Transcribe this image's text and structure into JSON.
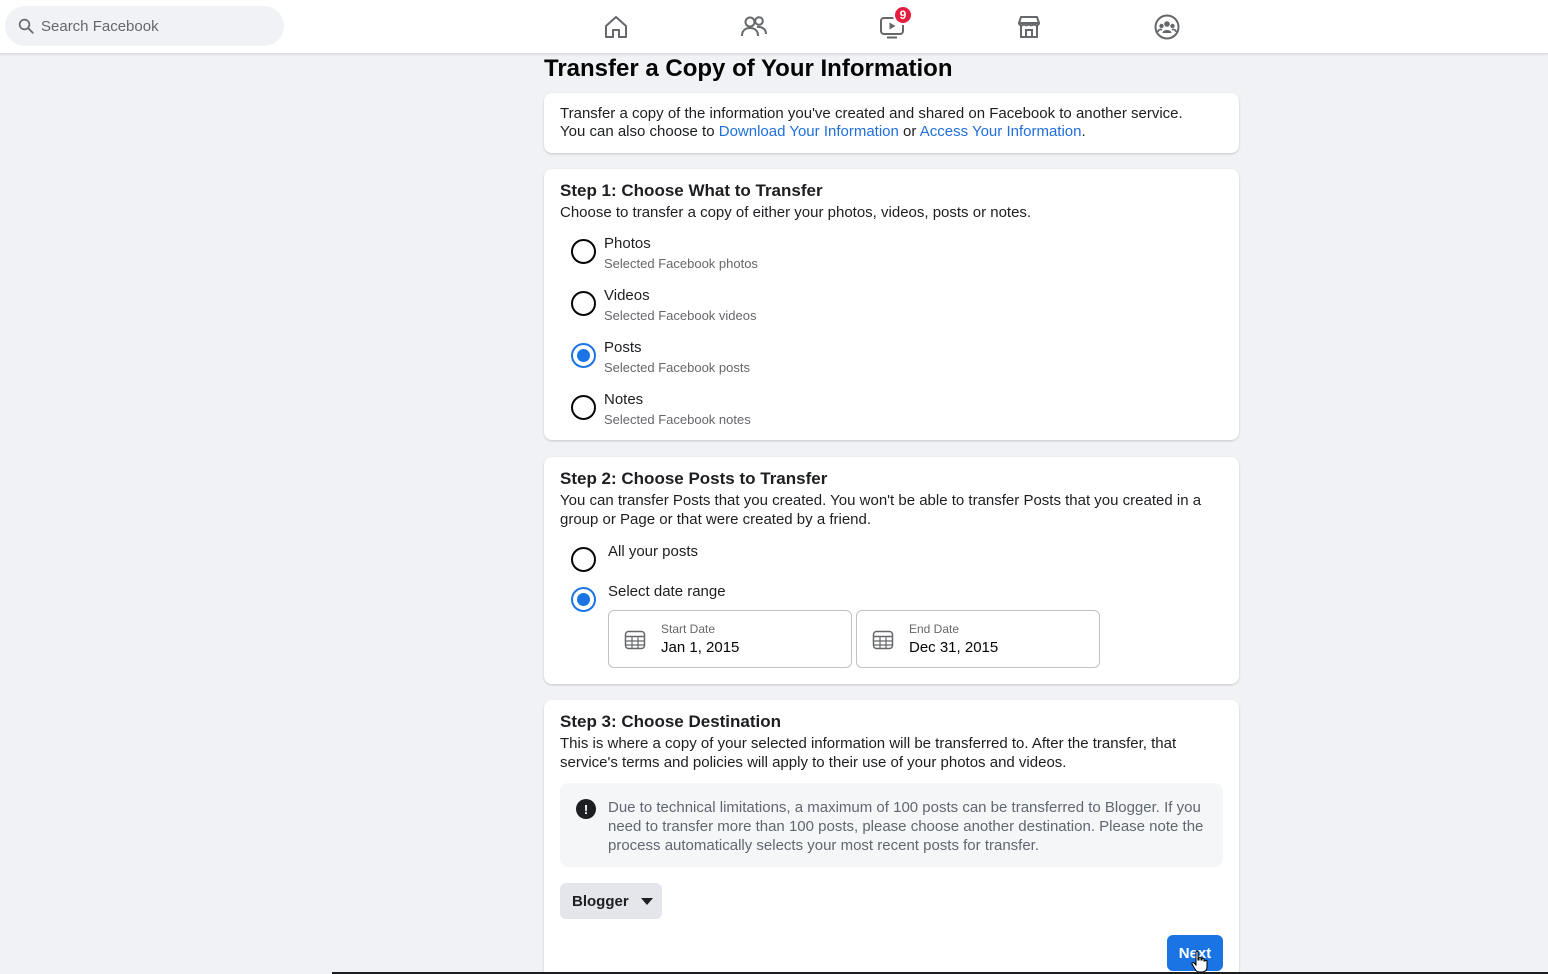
{
  "search": {
    "placeholder": "Search Facebook"
  },
  "nav": {
    "items": [
      {
        "icon": "home-icon"
      },
      {
        "icon": "friends-icon"
      },
      {
        "icon": "watch-icon",
        "badge": "9"
      },
      {
        "icon": "marketplace-icon"
      },
      {
        "icon": "groups-icon"
      }
    ]
  },
  "page": {
    "title": "Transfer a Copy of Your Information"
  },
  "intro": {
    "line1": "Transfer a copy of the information you've created and shared on Facebook to another service.",
    "line2_prefix": "You can also choose to ",
    "link1": "Download Your Information",
    "middle": " or ",
    "link2": "Access Your Information",
    "suffix": "."
  },
  "step1": {
    "title": "Step 1: Choose What to Transfer",
    "description": "Choose to transfer a copy of either your photos, videos, posts or notes.",
    "options": [
      {
        "label": "Photos",
        "sub": "Selected Facebook photos",
        "checked": false
      },
      {
        "label": "Videos",
        "sub": "Selected Facebook videos",
        "checked": false
      },
      {
        "label": "Posts",
        "sub": "Selected Facebook posts",
        "checked": true
      },
      {
        "label": "Notes",
        "sub": "Selected Facebook notes",
        "checked": false
      }
    ]
  },
  "step2": {
    "title": "Step 2: Choose Posts to Transfer",
    "description": "You can transfer Posts that you created. You won't be able to transfer Posts that you created in a group or Page or that were created by a friend.",
    "options": [
      {
        "label": "All your posts",
        "checked": false
      },
      {
        "label": "Select date range",
        "checked": true
      }
    ],
    "start_date": {
      "label": "Start Date",
      "value": "Jan 1, 2015"
    },
    "end_date": {
      "label": "End Date",
      "value": "Dec 31, 2015"
    }
  },
  "step3": {
    "title": "Step 3: Choose Destination",
    "description": "This is where a copy of your selected information will be transferred to. After the transfer, that service's terms and policies will apply to their use of your photos and videos.",
    "notice": "Due to technical limitations, a maximum of 100 posts can be transferred to Blogger. If you need to transfer more than 100 posts, please choose another destination. Please note the process automatically selects your most recent posts for transfer.",
    "destination": "Blogger",
    "next_label": "Next"
  },
  "colors": {
    "accent": "#1b74e4",
    "link": "#216fdb",
    "badge": "#e41e3f",
    "background": "#f0f2f5"
  }
}
